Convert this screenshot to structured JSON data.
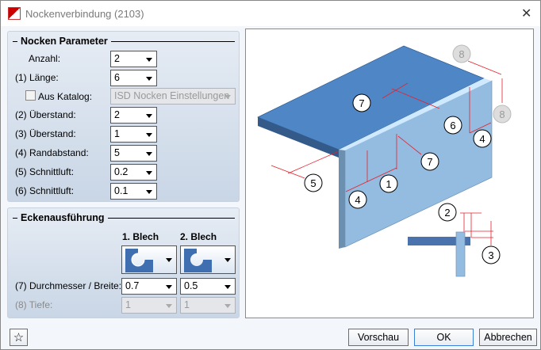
{
  "window": {
    "title": "Nockenverbindung (2103)",
    "close_icon": "close-icon",
    "app_icon": "hicad-app-icon"
  },
  "nocken": {
    "title": "Nocken Parameter",
    "anzahl": {
      "label": "Anzahl:",
      "value": "2"
    },
    "laenge": {
      "label": "(1) Länge:",
      "value": "6"
    },
    "katalog": {
      "label": "Aus Katalog:",
      "checked": false,
      "value": "ISD Nocken Einstellungen"
    },
    "ueberstand2": {
      "label": "(2) Überstand:",
      "value": "2"
    },
    "ueberstand3": {
      "label": "(3) Überstand:",
      "value": "1"
    },
    "randabstand": {
      "label": "(4) Randabstand:",
      "value": "5"
    },
    "schnittluft5": {
      "label": "(5) Schnittluft:",
      "value": "0.2"
    },
    "schnittluft6": {
      "label": "(6) Schnittluft:",
      "value": "0.1"
    }
  },
  "ecken": {
    "title": "Eckenausführung",
    "col1": "1. Blech",
    "col2": "2. Blech",
    "durchmesser": {
      "label": "(7) Durchmesser / Breite:",
      "value1": "0.7",
      "value2": "0.5"
    },
    "tiefe": {
      "label": "(8) Tiefe:",
      "value1": "1",
      "value2": "1"
    }
  },
  "diagram": {
    "labels": [
      "8",
      "7",
      "8",
      "6",
      "4",
      "7",
      "5",
      "1",
      "4",
      "2",
      "3"
    ],
    "plate_color": "#4f86c6",
    "wall_color": "#93bce0",
    "dim_color": "#e8202a"
  },
  "buttons": {
    "preview": "Vorschau",
    "ok": "OK",
    "cancel": "Abbrechen",
    "favorite_icon": "star-icon"
  }
}
